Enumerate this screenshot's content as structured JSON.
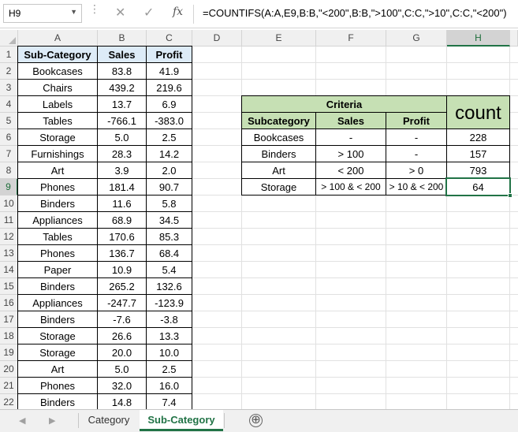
{
  "formula_bar": {
    "name_box": "H9",
    "name_box_arrow": "▼",
    "cancel_icon": "✕",
    "enter_icon": "✓",
    "fx_label": "fx",
    "formula": "=COUNTIFS(A:A,E9,B:B,\"<200\",B:B,\">100\",C:C,\">10\",C:C,\"<200\")"
  },
  "columns": [
    "A",
    "B",
    "C",
    "D",
    "E",
    "F",
    "G",
    "H"
  ],
  "selected_column": "H",
  "rows": [
    "1",
    "2",
    "3",
    "4",
    "5",
    "6",
    "7",
    "8",
    "9",
    "10",
    "11",
    "12",
    "13",
    "14",
    "15",
    "16",
    "17",
    "18",
    "19",
    "20",
    "21",
    "22"
  ],
  "selected_row": "9",
  "data_table": {
    "headers": [
      "Sub-Category",
      "Sales",
      "Profit"
    ],
    "rows": [
      [
        "Bookcases",
        "83.8",
        "41.9"
      ],
      [
        "Chairs",
        "439.2",
        "219.6"
      ],
      [
        "Labels",
        "13.7",
        "6.9"
      ],
      [
        "Tables",
        "-766.1",
        "-383.0"
      ],
      [
        "Storage",
        "5.0",
        "2.5"
      ],
      [
        "Furnishings",
        "28.3",
        "14.2"
      ],
      [
        "Art",
        "3.9",
        "2.0"
      ],
      [
        "Phones",
        "181.4",
        "90.7"
      ],
      [
        "Binders",
        "11.6",
        "5.8"
      ],
      [
        "Appliances",
        "68.9",
        "34.5"
      ],
      [
        "Tables",
        "170.6",
        "85.3"
      ],
      [
        "Phones",
        "136.7",
        "68.4"
      ],
      [
        "Paper",
        "10.9",
        "5.4"
      ],
      [
        "Binders",
        "265.2",
        "132.6"
      ],
      [
        "Appliances",
        "-247.7",
        "-123.9"
      ],
      [
        "Binders",
        "-7.6",
        "-3.8"
      ],
      [
        "Storage",
        "26.6",
        "13.3"
      ],
      [
        "Storage",
        "20.0",
        "10.0"
      ],
      [
        "Art",
        "5.0",
        "2.5"
      ],
      [
        "Phones",
        "32.0",
        "16.0"
      ],
      [
        "Binders",
        "14.8",
        "7.4"
      ]
    ]
  },
  "criteria_table": {
    "title": "Criteria",
    "count_label": "count",
    "headers": [
      "Subcategory",
      "Sales",
      "Profit"
    ],
    "rows": [
      [
        "Bookcases",
        "-",
        "-",
        "228"
      ],
      [
        "Binders",
        "> 100",
        "-",
        "157"
      ],
      [
        "Art",
        "< 200",
        "> 0",
        "793"
      ],
      [
        "Storage",
        "> 100 & < 200",
        "> 10 & < 200",
        "64"
      ]
    ]
  },
  "tabs": {
    "items": [
      "Category",
      "Sub-Category"
    ],
    "active": "Sub-Category",
    "add_icon": "⊕",
    "prev_icon": "◀",
    "next_icon": "▶"
  },
  "colors": {
    "accent": "#217346",
    "header_green": "#c6e0b4",
    "header_blue": "#ddebf7"
  },
  "icons": [
    "cancel-icon",
    "enter-icon",
    "function-icon",
    "add-sheet-icon"
  ]
}
